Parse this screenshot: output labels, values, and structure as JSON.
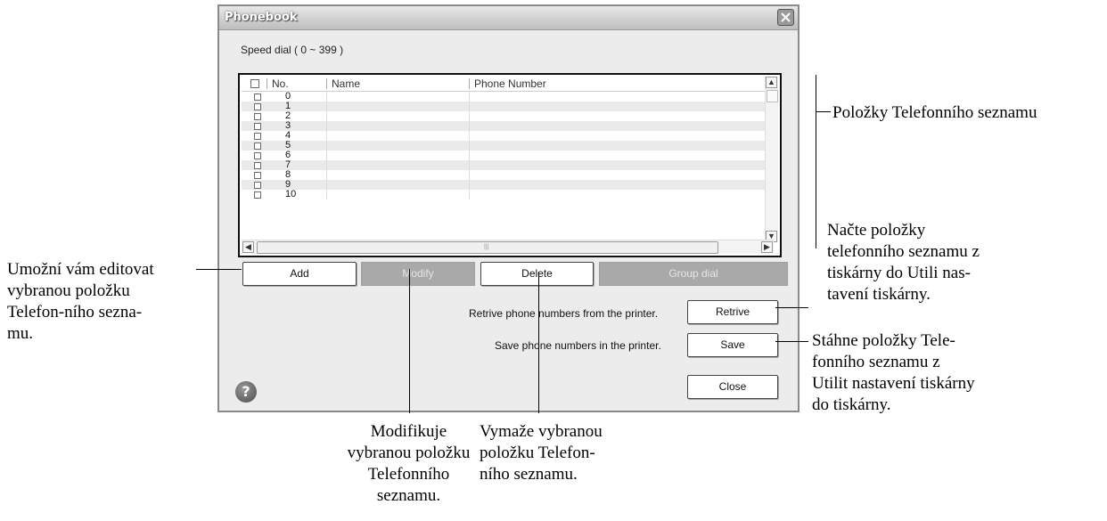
{
  "window": {
    "title": "Phonebook"
  },
  "speed_dial_label": "Speed dial ( 0 ~ 399 )",
  "table": {
    "headers": [
      "No.",
      "Name",
      "Phone Number"
    ],
    "rows": [
      "0",
      "1",
      "2",
      "3",
      "4",
      "5",
      "6",
      "7",
      "8",
      "9",
      "10"
    ]
  },
  "buttons": {
    "add": "Add",
    "modify": "Modify",
    "delete": "Delete",
    "group_dial": "Group dial",
    "retrive": "Retrive",
    "save": "Save",
    "close": "Close"
  },
  "labels": {
    "retrive": "Retrive phone numbers from the printer.",
    "save": "Save phone numbers in the printer."
  },
  "annotations": {
    "entries": "Položky Telefonního seznamu",
    "add": [
      "Umožní vám editovat",
      "vybranou položku",
      "Telefon-ního sezna-",
      "mu."
    ],
    "retrive": [
      "Načte položky",
      "telefonního seznamu z",
      "tiskárny do Utili nas-",
      "tavení tiskárny."
    ],
    "save": [
      "Stáhne položky Tele-",
      "fonního seznamu z",
      "Utilit nastavení tiskárny",
      "do tiskárny."
    ],
    "modify": [
      "Modifikuje",
      "vybranou položku",
      "Telefonního",
      "seznamu."
    ],
    "delete": [
      "Vymaže vybranou",
      "položku Telefon-",
      "ního seznamu."
    ]
  }
}
